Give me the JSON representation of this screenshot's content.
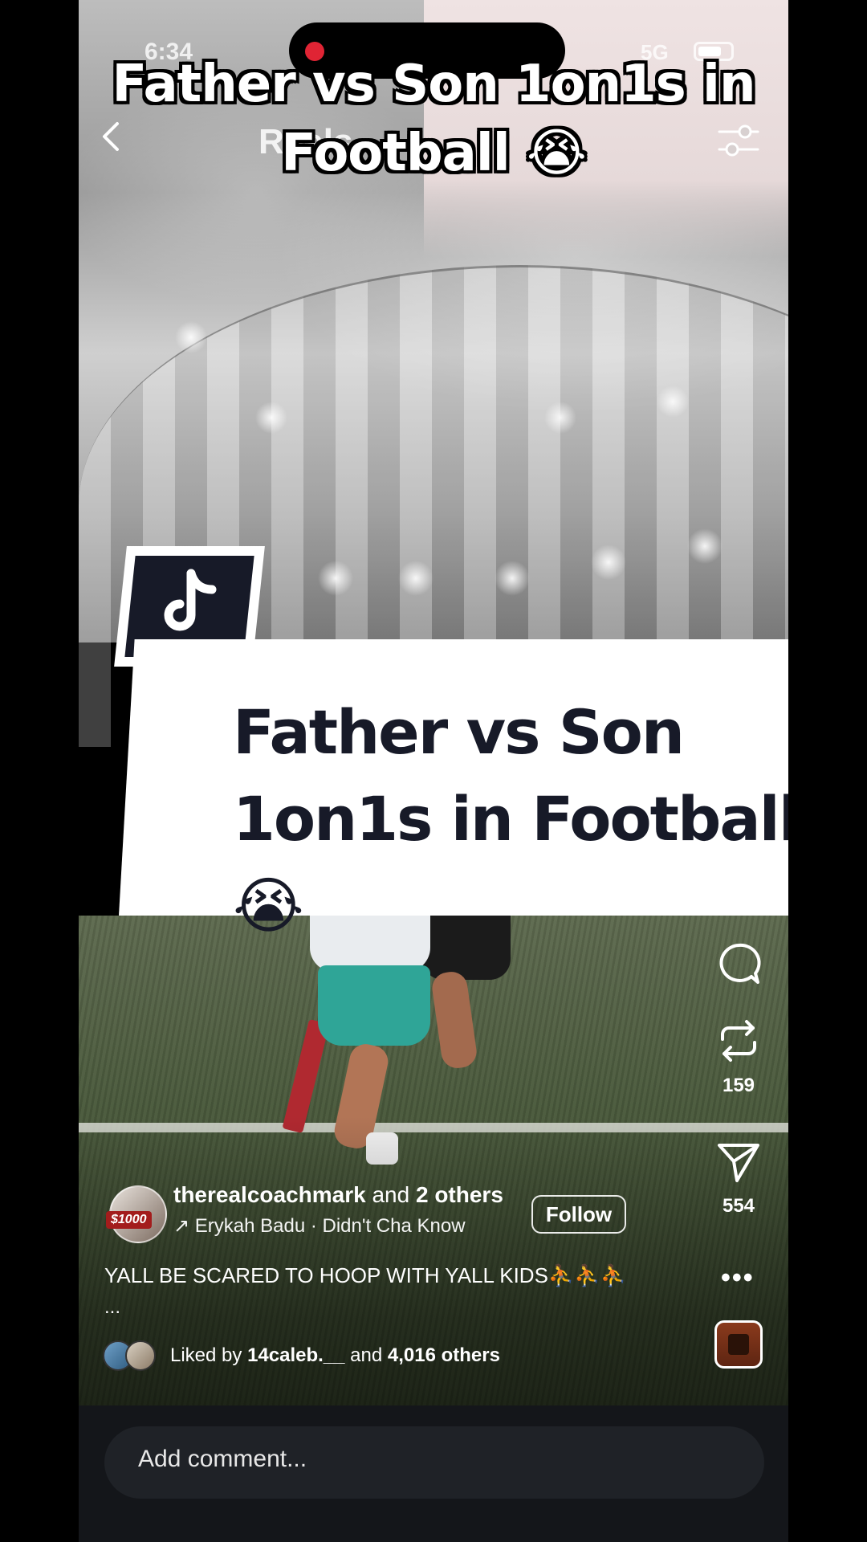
{
  "status": {
    "time": "6:34",
    "network": "5G"
  },
  "header": {
    "title": "Reels",
    "back_icon": "chevron-left-icon",
    "filter_icon": "filter-icon"
  },
  "overlay_caption": "Father vs Son 1on1s in Football 😭",
  "banner": {
    "line1": "Father vs Son",
    "line2": "1on1s in Football😭",
    "logo_icon": "tiktok-logo-icon"
  },
  "rail": {
    "comment_icon": "comment-icon",
    "repost_icon": "repost-icon",
    "repost_count": "159",
    "share_icon": "send-icon",
    "share_count": "554",
    "more_label": "•••"
  },
  "author": {
    "username": "therealcoachmark",
    "and_text": " and ",
    "others": "2 others",
    "badge": "$1000",
    "audio": "↗ Erykah Badu · Didn't Cha Know",
    "follow_label": "Follow"
  },
  "caption": {
    "text": "YALL BE SCARED TO HOOP WITH YALL KIDS⛹️⛹️⛹️",
    "more": "..."
  },
  "likes": {
    "prefix": "Liked by ",
    "user": "14caleb.__",
    "mid": " and ",
    "others": "4,016 others"
  },
  "comment": {
    "placeholder": "Add comment..."
  },
  "colors": {
    "banner_bg": "#ffffff",
    "banner_text": "#171a28",
    "record_dot": "#e02434",
    "comment_bar": "#14161a"
  }
}
